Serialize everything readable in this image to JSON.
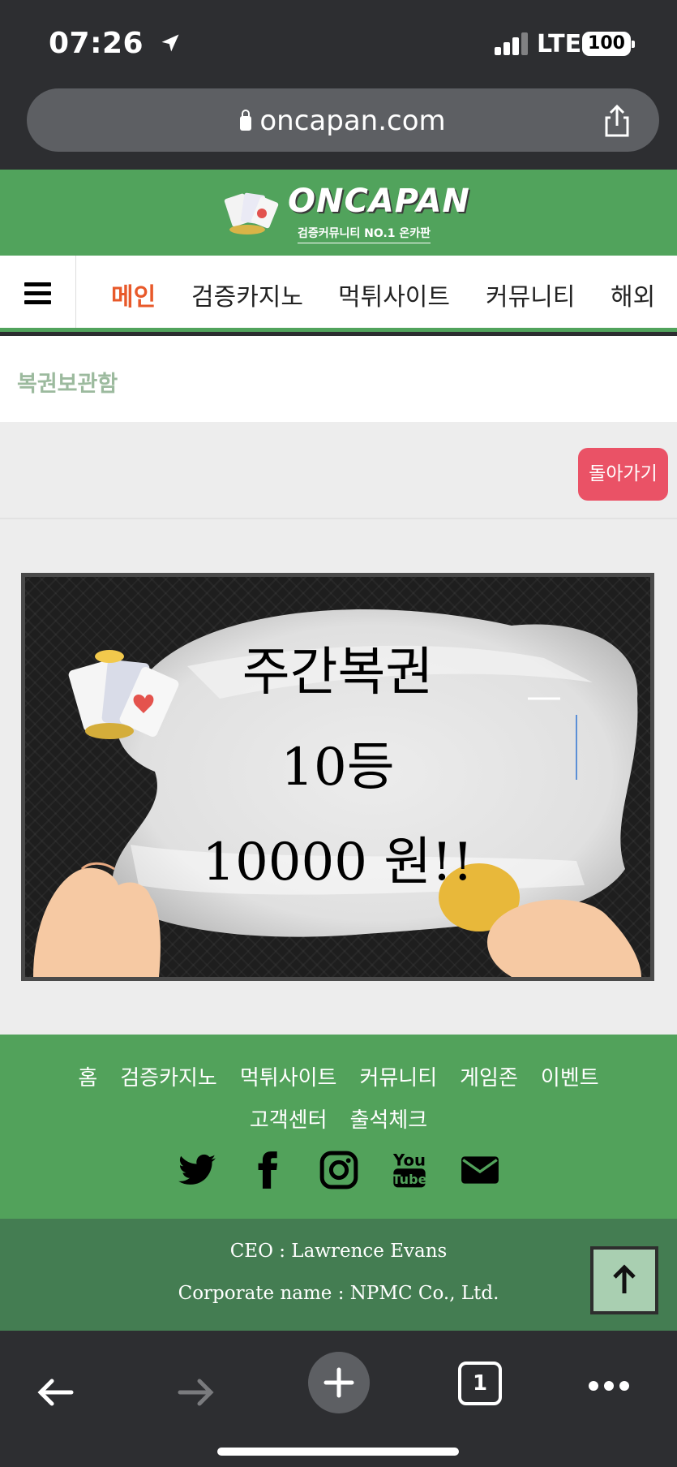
{
  "status_bar": {
    "time": "07:26",
    "network": "LTE",
    "battery": "100"
  },
  "browser": {
    "url": "oncapan.com"
  },
  "site": {
    "logo_text": "ONCAPAN",
    "logo_sub": "검증커뮤니티 NO.1 온카판",
    "brand_color": "#51a35c",
    "accent_color": "#e8592a"
  },
  "nav": {
    "items": [
      {
        "label": "메인",
        "active": true
      },
      {
        "label": "검증카지노",
        "active": false
      },
      {
        "label": "먹튀사이트",
        "active": false
      },
      {
        "label": "커뮤니티",
        "active": false
      },
      {
        "label": "해외",
        "active": false
      }
    ]
  },
  "page": {
    "title": "복권보관함",
    "back_label": "돌아가기"
  },
  "banner": {
    "line1": "주간복권",
    "line2": "10등",
    "line3": "10000 원!!"
  },
  "footer": {
    "links_row1": [
      "홈",
      "검증카지노",
      "먹튀사이트",
      "커뮤니티",
      "게임존",
      "이벤트"
    ],
    "links_row2": [
      "고객센터",
      "출석체크"
    ],
    "socials": [
      "twitter-icon",
      "facebook-icon",
      "instagram-icon",
      "youtube-icon",
      "mail-icon"
    ],
    "youtube_top": "You",
    "youtube_bottom": "Tube",
    "ceo": "CEO : Lawrence Evans",
    "corporate": "Corporate name : NPMC Co., Ltd."
  },
  "toolbar": {
    "tab_count": "1"
  }
}
